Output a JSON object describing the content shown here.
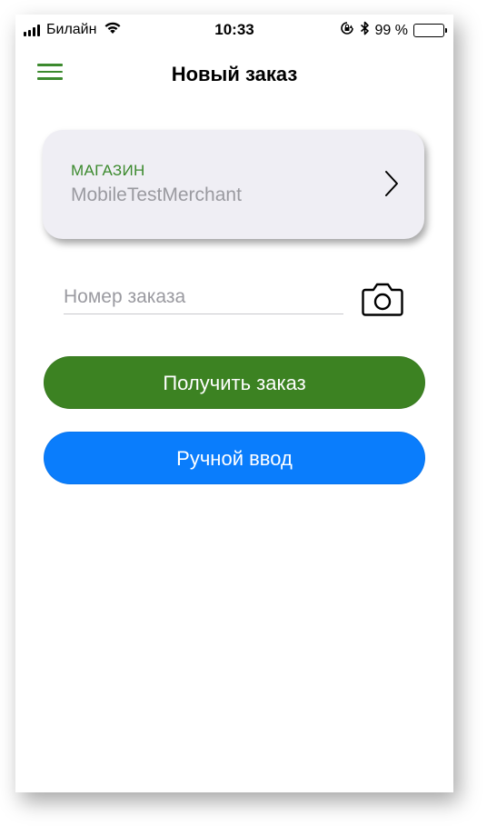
{
  "status_bar": {
    "carrier": "Билайн",
    "time": "10:33",
    "battery_percent": "99 %",
    "icons": [
      "signal-icon",
      "wifi-icon",
      "rotation-lock-icon",
      "bluetooth-icon",
      "battery-icon"
    ],
    "battery_color": "#ffcc00"
  },
  "nav": {
    "title": "Новый заказ",
    "menu_icon": "hamburger-menu-icon"
  },
  "store": {
    "caption": "МАГАЗИН",
    "value": "MobileTestMerchant",
    "icon": "chevron-right-icon"
  },
  "order": {
    "placeholder": "Номер заказа",
    "value": "",
    "scan_icon": "camera-icon"
  },
  "actions": {
    "get_order_label": "Получить заказ",
    "manual_entry_label": "Ручной ввод"
  },
  "colors": {
    "accent_green": "#3c8a2e",
    "button_green": "#3c8222",
    "button_blue": "#0a7dfc",
    "card_background": "#efeef4"
  }
}
